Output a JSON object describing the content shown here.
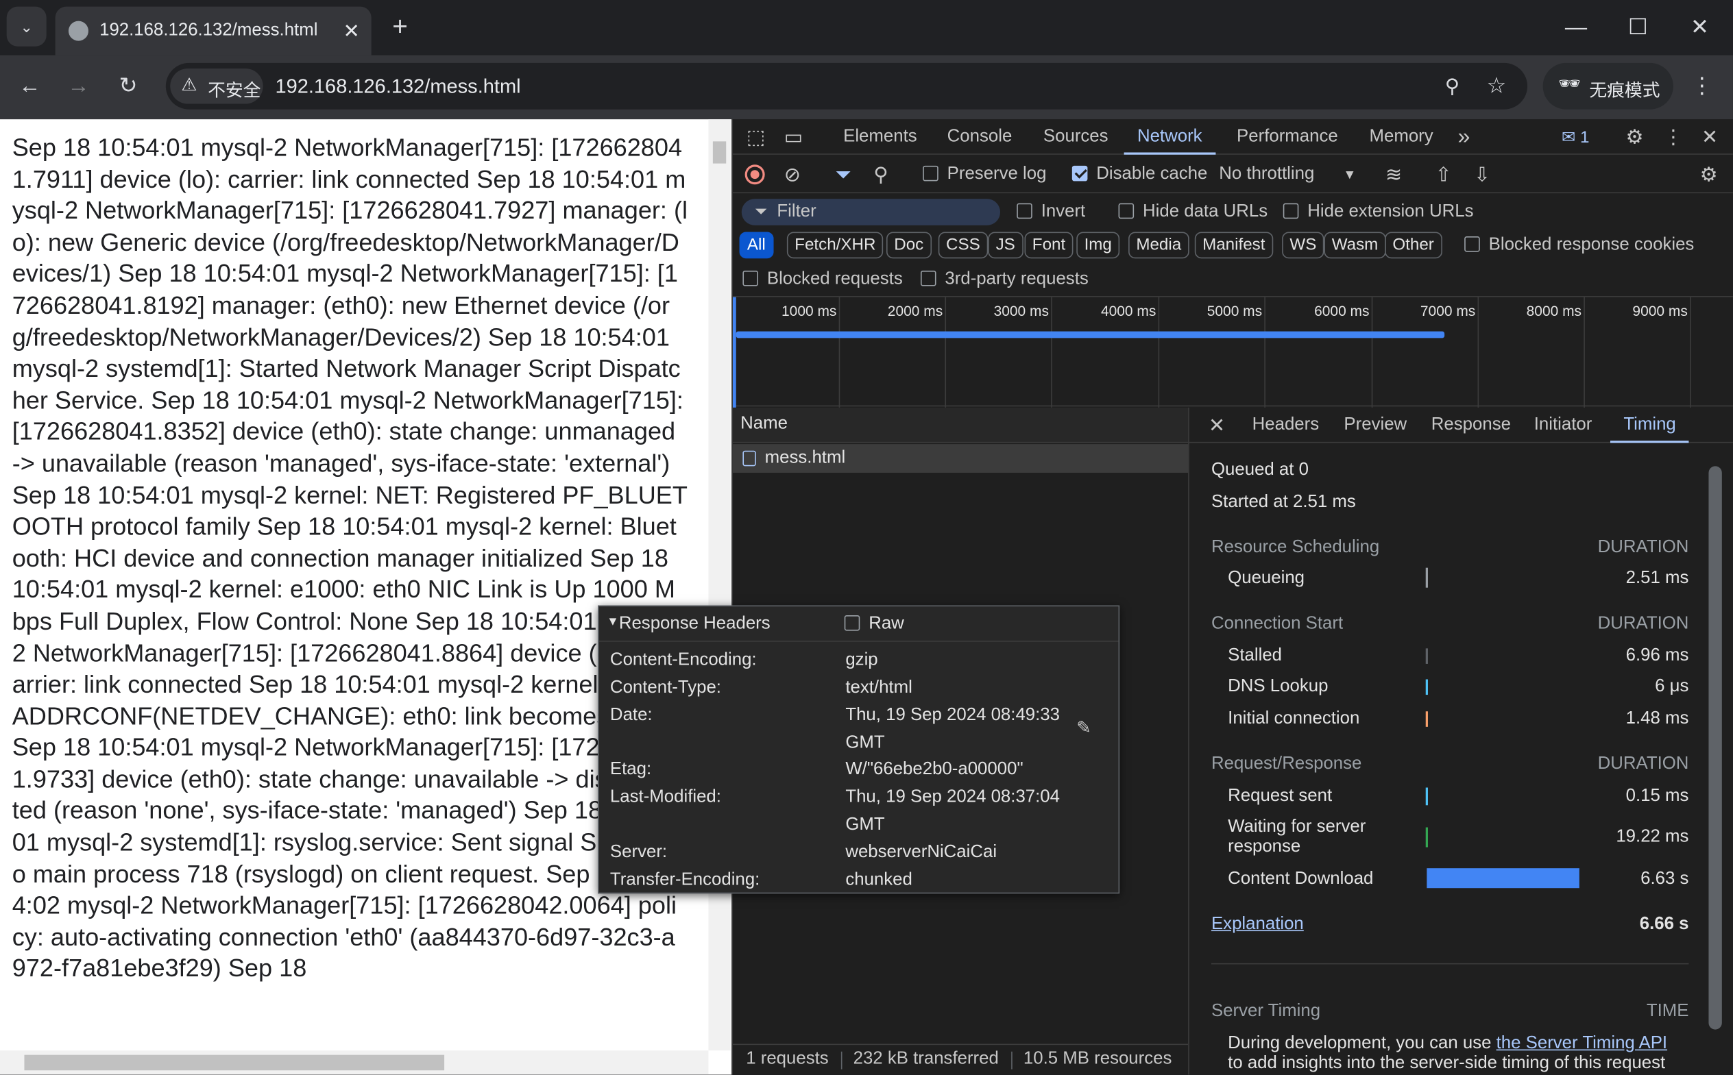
{
  "browser": {
    "tab_title": "192.168.126.132/mess.html",
    "new_tab": "+",
    "security_label": "不安全",
    "url": "192.168.126.132/mess.html",
    "incognito_label": "无痕模式"
  },
  "page": {
    "text": "Sep 18 10:54:01 mysql-2 NetworkManager[715]: [1726628041.7911] device (lo): carrier: link connected Sep 18 10:54:01 mysql-2 NetworkManager[715]: [1726628041.7927] manager: (lo): new Generic device (/org/freedesktop/NetworkManager/Devices/1) Sep 18 10:54:01 mysql-2 NetworkManager[715]: [1726628041.8192] manager: (eth0): new Ethernet device (/org/freedesktop/NetworkManager/Devices/2) Sep 18 10:54:01 mysql-2 systemd[1]: Started Network Manager Script Dispatcher Service. Sep 18 10:54:01 mysql-2 NetworkManager[715]: [1726628041.8352] device (eth0): state change: unmanaged -> unavailable (reason 'managed', sys-iface-state: 'external') Sep 18 10:54:01 mysql-2 kernel: NET: Registered PF_BLUETOOTH protocol family Sep 18 10:54:01 mysql-2 kernel: Bluetooth: HCI device and connection manager initialized Sep 18 10:54:01 mysql-2 kernel: e1000: eth0 NIC Link is Up 1000 Mbps Full Duplex, Flow Control: None Sep 18 10:54:01 mysql-2 NetworkManager[715]: [1726628041.8864] device (eth0): carrier: link connected Sep 18 10:54:01 mysql-2 kernel: IPv6: ADDRCONF(NETDEV_CHANGE): eth0: link becomes ready Sep 18 10:54:01 mysql-2 NetworkManager[715]: [1726628041.9733] device (eth0): state change: unavailable -> disconnected (reason 'none', sys-iface-state: 'managed') Sep 18 10:54:01 mysql-2 systemd[1]: rsyslog.service: Sent signal SIGHUP to main process 718 (rsyslogd) on client request. Sep 18 10:54:02 mysql-2 NetworkManager[715]: [1726628042.0064] policy: auto-activating connection 'eth0' (aa844370-6d97-32c3-a972-f7a81ebe3f29) Sep 18"
  },
  "devtools": {
    "tabs": [
      "Elements",
      "Console",
      "Sources",
      "Network",
      "Performance",
      "Memory"
    ],
    "more_tabs": "»",
    "issues_count": "1",
    "toolbar": {
      "preserve_log": "Preserve log",
      "disable_cache": "Disable cache",
      "throttling": "No throttling"
    },
    "filter": {
      "placeholder": "Filter",
      "invert": "Invert",
      "hide_data_urls": "Hide data URLs",
      "hide_extension_urls": "Hide extension URLs",
      "blocked_response_cookies": "Blocked response cookies",
      "blocked_requests": "Blocked requests",
      "third_party": "3rd-party requests"
    },
    "type_filters": [
      "All",
      "Fetch/XHR",
      "Doc",
      "CSS",
      "JS",
      "Font",
      "Img",
      "Media",
      "Manifest",
      "WS",
      "Wasm",
      "Other"
    ],
    "timeline_ticks": [
      "1000 ms",
      "2000 ms",
      "3000 ms",
      "4000 ms",
      "5000 ms",
      "6000 ms",
      "7000 ms",
      "8000 ms",
      "9000 ms"
    ],
    "requests_header": "Name",
    "request_name": "mess.html",
    "detail_tabs": [
      "Headers",
      "Preview",
      "Response",
      "Initiator",
      "Timing"
    ],
    "status_bar": {
      "requests": "1 requests",
      "transferred": "232 kB transferred",
      "resources": "10.5 MB resources"
    },
    "accent": "#a8c7fa",
    "bar_color": "#4285f4"
  },
  "timing": {
    "queued": "Queued at 0",
    "started": "Started at 2.51 ms",
    "duration_label": "DURATION",
    "groups": {
      "scheduling": {
        "title": "Resource Scheduling",
        "rows": [
          {
            "label": "Queueing",
            "value": "2.51 ms"
          }
        ]
      },
      "connection": {
        "title": "Connection Start",
        "rows": [
          {
            "label": "Stalled",
            "value": "6.96 ms"
          },
          {
            "label": "DNS Lookup",
            "value": "6 μs"
          },
          {
            "label": "Initial connection",
            "value": "1.48 ms"
          }
        ]
      },
      "request": {
        "title": "Request/Response",
        "rows": [
          {
            "label": "Request sent",
            "value": "0.15 ms"
          },
          {
            "label": "Waiting for server",
            "label2": "response",
            "value": "19.22 ms"
          },
          {
            "label": "Content Download",
            "value": "6.63 s"
          }
        ]
      }
    },
    "explanation": "Explanation",
    "total": "6.66 s",
    "server_timing": {
      "title": "Server Timing",
      "time_label": "TIME",
      "desc_before": "During development, you can use ",
      "link": "the Server Timing API",
      "desc_after": "to add insights into the server-side timing of this request"
    }
  },
  "popup": {
    "title": "Response Headers",
    "raw": "Raw",
    "headers": [
      {
        "key": "Content-Encoding:",
        "value": "gzip"
      },
      {
        "key": "Content-Type:",
        "value": "text/html"
      },
      {
        "key": "Date:",
        "value": "Thu, 19 Sep 2024 08:49:33 GMT"
      },
      {
        "key": "Etag:",
        "value": "W/\"66ebe2b0-a00000\""
      },
      {
        "key": "Last-Modified:",
        "value": "Thu, 19 Sep 2024 08:37:04 GMT"
      },
      {
        "key": "Server:",
        "value": "webserverNiCaiCai"
      },
      {
        "key": "Transfer-Encoding:",
        "value": "chunked"
      }
    ]
  }
}
